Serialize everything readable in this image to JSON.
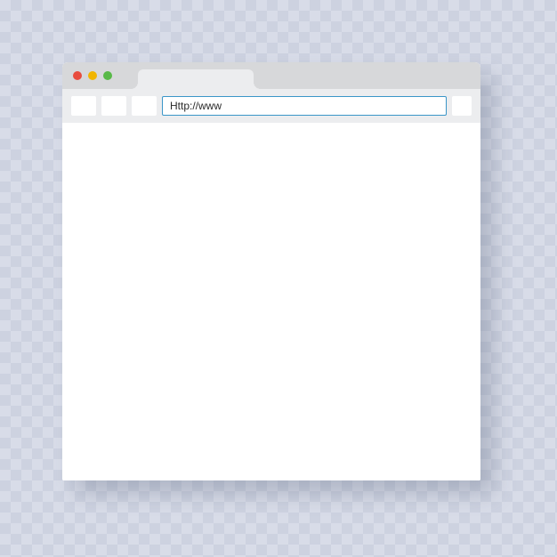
{
  "address_bar": {
    "value": "Http://www"
  },
  "colors": {
    "traffic_red": "#e84c3d",
    "traffic_yellow": "#f1b500",
    "traffic_green": "#58b947",
    "address_border": "#3a96c8",
    "title_bar": "#d7d8da",
    "toolbar": "#ecedef"
  }
}
